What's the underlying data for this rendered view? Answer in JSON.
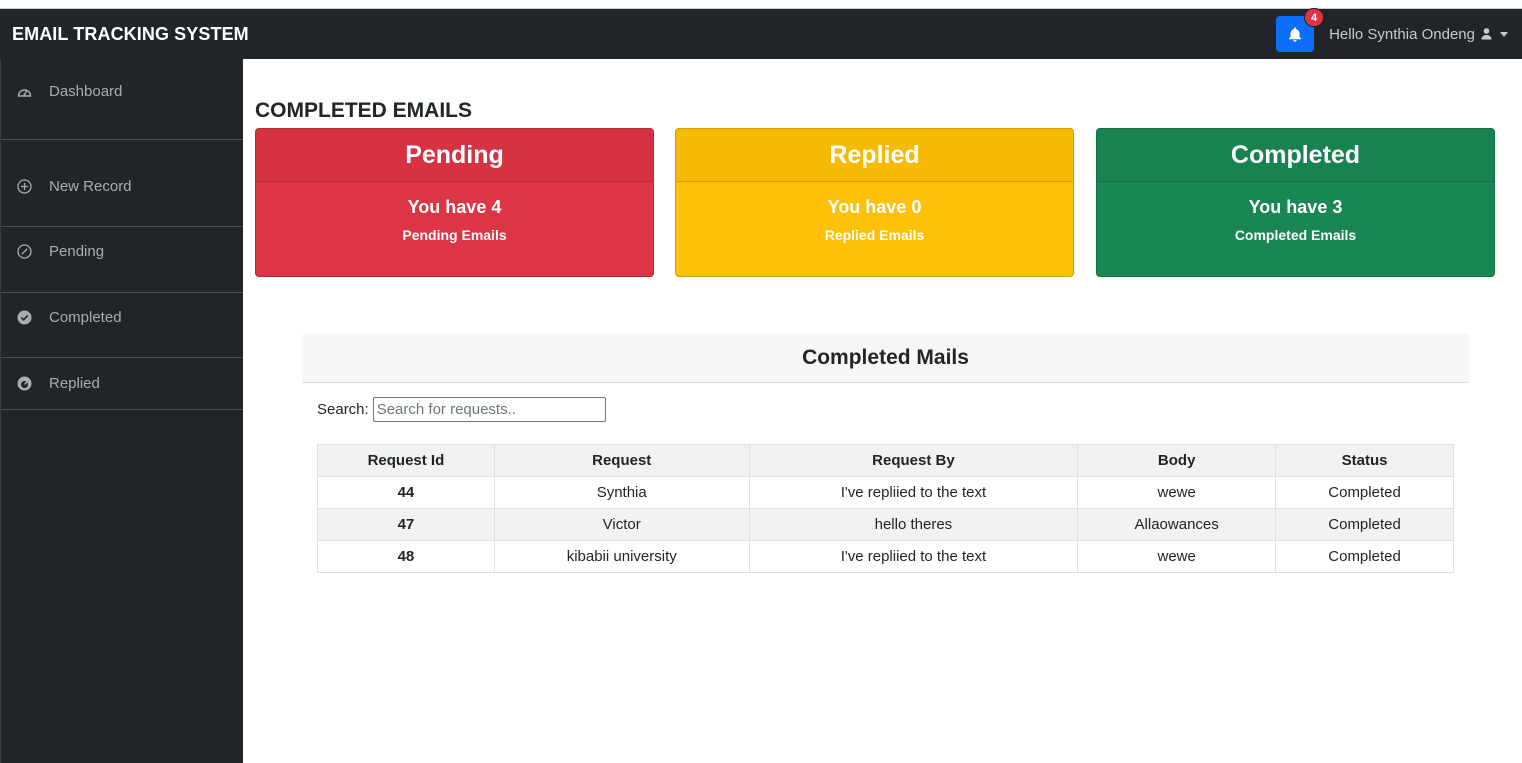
{
  "navbar": {
    "brand": "EMAIL TRACKING SYSTEM",
    "notification_count": "4",
    "user_greeting": "Hello Synthia Ondeng",
    "brand_color": "#212529",
    "bell_color": "#0d6efd",
    "badge_color": "#dc3545"
  },
  "sidebar": {
    "items": [
      {
        "label": "Dashboard",
        "icon": "gauge-icon"
      },
      {
        "label": "New Record",
        "icon": "plus-circle-icon"
      },
      {
        "label": "Pending",
        "icon": "ban-circle-icon"
      },
      {
        "label": "Completed",
        "icon": "check-circle-icon"
      },
      {
        "label": "Replied",
        "icon": "dashboard-dial-icon"
      }
    ]
  },
  "main": {
    "page_title": "COMPLETED EMAILS",
    "cards": [
      {
        "title": "Pending",
        "line1": "You have 4",
        "line2": "Pending Emails",
        "color": "#dc3545"
      },
      {
        "title": "Replied",
        "line1": "You have 0",
        "line2": "Replied Emails",
        "color": "#ffc107"
      },
      {
        "title": "Completed",
        "line1": "You have 3",
        "line2": "Completed Emails",
        "color": "#198754"
      }
    ],
    "panel": {
      "title": "Completed Mails",
      "search_label": "Search:",
      "search_placeholder": "Search for requests..",
      "columns": [
        "Request Id",
        "Request",
        "Request By",
        "Body",
        "Status"
      ],
      "rows": [
        [
          "44",
          "Synthia",
          "I've repliied to the text",
          "wewe",
          "Completed"
        ],
        [
          "47",
          "Victor",
          "hello theres",
          "Allaowances",
          "Completed"
        ],
        [
          "48",
          "kibabii university",
          "I've repliied to the text",
          "wewe",
          "Completed"
        ]
      ]
    }
  }
}
